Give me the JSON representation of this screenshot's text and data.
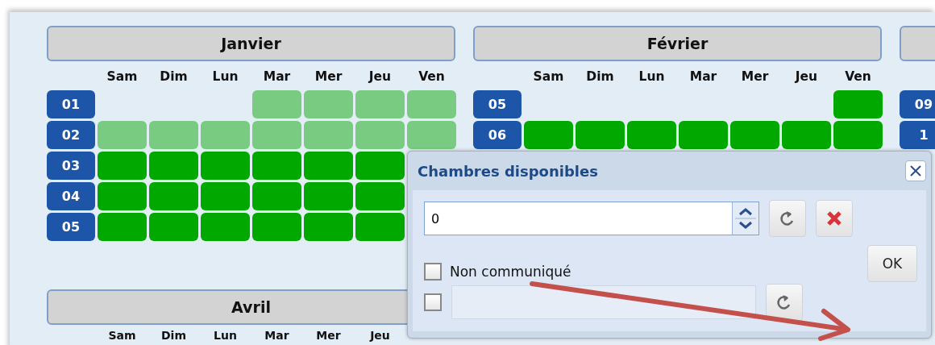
{
  "months": [
    {
      "name": "Janvier",
      "day_labels": [
        "Sam",
        "Dim",
        "Lun",
        "Mar",
        "Mer",
        "Jeu",
        "Ven"
      ],
      "weeks": [
        {
          "number": "01",
          "kind": "first",
          "days": [
            {
              "color": "#78cb81"
            },
            {
              "color": "#78cb81"
            },
            {
              "color": "#78cb81"
            },
            {
              "color": "#78cb81"
            }
          ]
        },
        {
          "number": "02",
          "kind": "regular",
          "days": [
            {
              "color": "#78cb81"
            },
            {
              "color": "#78cb81"
            },
            {
              "color": "#78cb81"
            },
            {
              "color": "#78cb81"
            },
            {
              "color": "#78cb81"
            },
            {
              "color": "#78cb81"
            },
            {
              "color": "#78cb81"
            }
          ]
        },
        {
          "number": "03",
          "kind": "regular",
          "days": [
            {
              "color": "#00a800"
            },
            {
              "color": "#00a800"
            },
            {
              "color": "#00a800"
            },
            {
              "color": "#00a800"
            },
            {
              "color": "#00a800"
            },
            {
              "color": "#00a800"
            }
          ]
        },
        {
          "number": "04",
          "kind": "regular",
          "days": [
            {
              "color": "#00a800"
            },
            {
              "color": "#00a800"
            },
            {
              "color": "#00a800"
            },
            {
              "color": "#00a800"
            },
            {
              "color": "#00a800"
            },
            {
              "color": "#00a800"
            }
          ]
        },
        {
          "number": "05",
          "kind": "regular",
          "days": [
            {
              "color": "#00a800"
            },
            {
              "color": "#00a800"
            },
            {
              "color": "#00a800"
            },
            {
              "color": "#00a800"
            },
            {
              "color": "#00a800"
            },
            {
              "color": "#00a800"
            }
          ]
        }
      ]
    },
    {
      "name": "Février",
      "day_labels": [
        "Sam",
        "Dim",
        "Lun",
        "Mar",
        "Mer",
        "Jeu",
        "Ven"
      ],
      "weeks": [
        {
          "number": "05",
          "kind": "first",
          "days": [
            {
              "color": "#00a800"
            }
          ]
        },
        {
          "number": "06",
          "kind": "regular",
          "days": [
            {
              "color": "#00a800"
            },
            {
              "color": "#00a800"
            },
            {
              "color": "#00a800"
            },
            {
              "color": "#00a800"
            },
            {
              "color": "#00a800"
            },
            {
              "color": "#00a800"
            },
            {
              "color": "#00a800"
            }
          ]
        }
      ]
    },
    {
      "weeks": [
        {
          "number": "09"
        },
        {
          "number": "1"
        }
      ]
    },
    {
      "name": "Avril",
      "day_labels": [
        "Sam",
        "Dim",
        "Lun",
        "Mar",
        "Mer",
        "Jeu"
      ]
    }
  ],
  "dialog": {
    "title": "Chambres disponibles",
    "value": "0",
    "not_communicated": {
      "label": "Non communiqué",
      "checked": false
    },
    "second_checkbox": {
      "checked": false
    },
    "second_field": {
      "disabled": true
    },
    "ok": "OK"
  }
}
